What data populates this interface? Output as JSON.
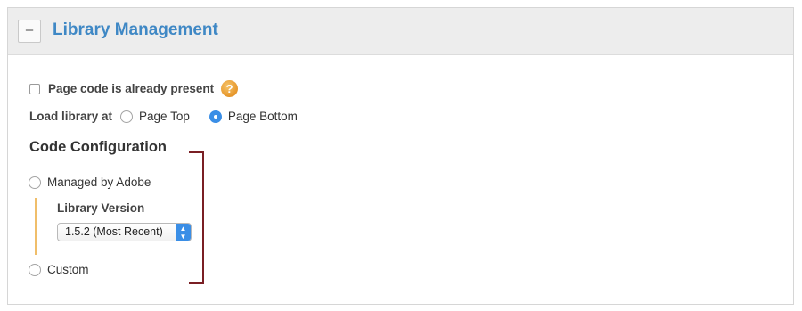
{
  "panel": {
    "collapse_symbol": "–",
    "title": "Library Management"
  },
  "page_code": {
    "checkbox_checked": false,
    "label": "Page code is already present",
    "help_symbol": "?"
  },
  "load_library": {
    "label": "Load library at",
    "options": [
      {
        "label": "Page Top",
        "selected": false
      },
      {
        "label": "Page Bottom",
        "selected": true
      }
    ]
  },
  "code_configuration": {
    "heading": "Code Configuration",
    "managed_label": "Managed by Adobe",
    "managed_selected": false,
    "library_version_label": "Library Version",
    "library_version_value": "1.5.2 (Most Recent)",
    "custom_label": "Custom",
    "custom_selected": false
  },
  "colors": {
    "title": "#3f88c5",
    "radio_selected": "#3a8ee6",
    "bracket": "#7a1f24",
    "version_bar": "#f0be6a",
    "help_icon": "#e6962a"
  }
}
